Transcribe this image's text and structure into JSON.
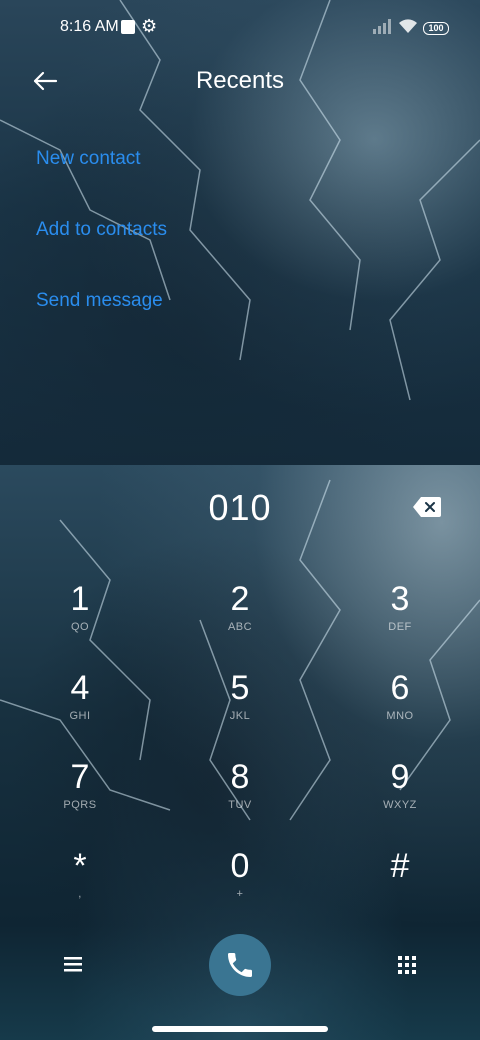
{
  "status_bar": {
    "time": "8:16 AM",
    "battery": "100"
  },
  "header": {
    "title": "Recents"
  },
  "options": [
    "New contact",
    "Add to contacts",
    "Send message"
  ],
  "dialer": {
    "number": "010"
  },
  "keys": [
    {
      "digit": "1",
      "letters": "QO"
    },
    {
      "digit": "2",
      "letters": "ABC"
    },
    {
      "digit": "3",
      "letters": "DEF"
    },
    {
      "digit": "4",
      "letters": "GHI"
    },
    {
      "digit": "5",
      "letters": "JKL"
    },
    {
      "digit": "6",
      "letters": "MNO"
    },
    {
      "digit": "7",
      "letters": "PQRS"
    },
    {
      "digit": "8",
      "letters": "TUV"
    },
    {
      "digit": "9",
      "letters": "WXYZ"
    },
    {
      "digit": "*",
      "letters": ","
    },
    {
      "digit": "0",
      "letters": "+"
    },
    {
      "digit": "#",
      "letters": ""
    }
  ],
  "icons": {
    "back": "arrow-left-icon",
    "backspace": "backspace-icon",
    "menu": "hamburger-menu-icon",
    "call": "phone-icon",
    "dialpad": "dialpad-icon",
    "settings": "gear-icon"
  },
  "colors": {
    "accent": "#2a8dee",
    "call_button": "#3a7592"
  }
}
